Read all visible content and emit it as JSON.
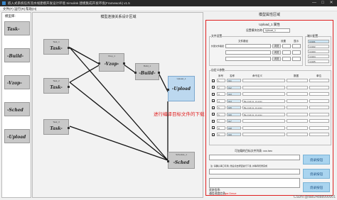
{
  "window": {
    "title": "嵌入式系统任务流水线建模开发设计环境 Simulink 建模集成开发环境(Framework) v1.5",
    "controls": [
      "—",
      "□",
      "✕"
    ]
  },
  "menu": {
    "items": [
      "文件(F)",
      "运行(R)",
      "帮助(H)"
    ]
  },
  "palette": {
    "title": "模型库:",
    "blocks": [
      {
        "tag": "",
        "label": "Task-"
      },
      {
        "tag": "",
        "label": "-Build-"
      },
      {
        "tag": "",
        "label": "-Vzop-"
      },
      {
        "tag": "",
        "label": "-Sched"
      },
      {
        "tag": "",
        "label": "-Upload"
      }
    ]
  },
  "canvas": {
    "title": "模型连接关系设计区域",
    "annotation": "进行编译目标文件的下载",
    "nodes": [
      {
        "tag": "Task_1",
        "label": "Task-"
      },
      {
        "tag": "Task_2",
        "label": "Task-"
      },
      {
        "tag": "Task_3",
        "label": "Task-"
      },
      {
        "tag": "Vzop_1",
        "label": "-Vzop-"
      },
      {
        "tag": "Build_1",
        "label": "-Build-"
      },
      {
        "tag": "Upload_1",
        "label": "-Upload"
      },
      {
        "tag": "Schedule_1",
        "label": "-Sched"
      }
    ]
  },
  "props": {
    "panel_title": "模型属性区域",
    "module_title": "Upload_1 属性",
    "name_label": "设置模块名称:",
    "name_value": "Upload_1",
    "file_section": {
      "title": "文件设置",
      "col_headers": [
        "",
        "文件路径",
        "",
        "设置",
        "显示"
      ],
      "rows": [
        {
          "label": "外部文件路径",
          "value": "",
          "btn": "浏览"
        },
        {
          "label": "",
          "value": "",
          "btn": "浏览"
        },
        {
          "label": "",
          "value": "",
          "btn": "浏览"
        }
      ]
    },
    "port_section": {
      "title": "端口配置",
      "options": [
        "COM1",
        "COM2",
        "COM3",
        "COM4",
        "COM5"
      ]
    },
    "param_section": {
      "title": "自定义参数",
      "col_headers": [
        "序号",
        "名称",
        "命令定义",
        "",
        "数据",
        "单位"
      ],
      "rows": [
        {
          "checked": true,
          "idx": "1",
          "name": "0x1",
          "cmd": ""
        },
        {
          "checked": true,
          "idx": "2",
          "name": "0x2",
          "cmd": ""
        },
        {
          "checked": true,
          "idx": "3",
          "name": "0x3",
          "cmd": ""
        },
        {
          "checked": true,
          "idx": "4",
          "name": "0x4",
          "cmd": "file cmd xx. xx.xxxx"
        },
        {
          "checked": true,
          "idx": "5",
          "name": "0x5",
          "cmd": "file cmd xx. xx.xxxx"
        },
        {
          "checked": true,
          "idx": "6",
          "name": "0x6",
          "cmd": "file cmd xx. xx.xxxx"
        },
        {
          "checked": true,
          "idx": "7",
          "name": "0x7",
          "cmd": ""
        },
        {
          "checked": true,
          "idx": "8",
          "name": "0x8",
          "cmd": ""
        },
        {
          "checked": true,
          "idx": "9",
          "name": "0x9",
          "cmd": ""
        }
      ]
    },
    "target_label": "可加载的目标文件列表: xxx.hex",
    "buttons": {
      "b1": "烧录按钮",
      "b2": "烧录按钮",
      "b3": "烧录按钮"
    },
    "hint": "注: 请确认串口可用, 然后点击按钮进行下载, 并等待烧录完成",
    "status_label": "状态信息:",
    "status_value": "",
    "progress_label": "通信进度信息:",
    "progress_value": "Ipa Dmue"
  },
  "watermark": "CSDN @tiao24888990001"
}
